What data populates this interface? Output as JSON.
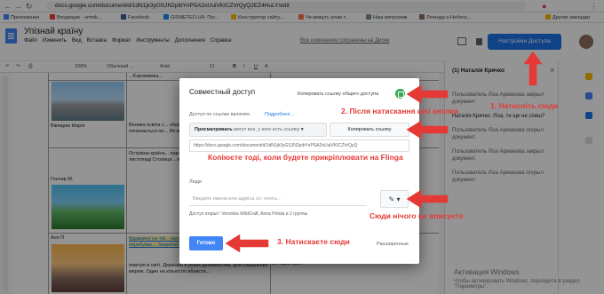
{
  "browser": {
    "url": "docs.google.com/document/d/1dN1jk3yGSJN2pibYnPSA2oUuiVKICZVrQyQ2EZ4HuLY/edit",
    "bookmarks": [
      "Приложения",
      "Входящие - ummk...",
      "Facebook",
      "GISMETEO.UA: Пог...",
      "Конструктор сайту...",
      "Чи можуть річки т...",
      "Наш випускник",
      "Легенда о Небесн...",
      "Другие закладки"
    ]
  },
  "docs": {
    "title": "Упізнай країну",
    "menu": [
      "Файл",
      "Изменить",
      "Вид",
      "Вставка",
      "Формат",
      "Инструменты",
      "Дополнения",
      "Справка"
    ],
    "last_edit": "Все изменения сохранены на Диске",
    "share_button": "Настройки Доступа",
    "toolbar": {
      "zoom": "100%",
      "style": "Обычный ...",
      "font": "Arial",
      "size": "11"
    }
  },
  "document": {
    "rows": [
      {
        "name": "",
        "text": "...Єзромамка..."
      },
      {
        "name": "Вівчарик Марія",
        "text": "Велика освіта с... обов'язкова, а... неграмотним. Не... починається не... Як можна дістатися... інформацією?"
      },
      {
        "name": "Гончар М.",
        "text": "Острівна країна... паралелі, низькі... сухий, особливо... листопаді Столиця... яку мають своє... ріка Банда."
      },
      {
        "name": "Аня П",
        "text": "Вдавнину на тій... населення Зем... рівні забрудненн... влади перебуває... Закритий доступ... З світових лідерів"
      },
      {
        "name": "",
        "text": "повітря в світі. Держава в руках духовенства. для соціальних мереж. Один на кількістю вбивств..."
      }
    ],
    "right_cell": "вівчарик Іран"
  },
  "comments": {
    "author": "(1) Наталія Крячко",
    "items": [
      "Пользователь Ліза Арманова закрыл документ.",
      "Наталія Крячко: Ліза, ти ще не спиш?",
      "Пользователь Ліза Арманова открыл документ.",
      "Пользователь Ліза Арманова закрыл документ.",
      "Пользователь Ліза Арманова открыл документ."
    ]
  },
  "windows": {
    "activation_title": "Активация Windows",
    "activation_text": "Чтобы активировать Windows, перейдите в раздел \"Параметры\"."
  },
  "dialog": {
    "title": "Совместный доступ",
    "copy_shared_link": "Копировать ссылку общего доступа",
    "link_enabled": "Доступ по ссылке включен",
    "more": "Подробнее...",
    "access_bold": "Просматривать",
    "access_rest": "могут все, у кого есть ссылку",
    "copy_link_button": "Копировать ссылку",
    "link": "https://docs.google.com/document/d/1dN1jk3yGSJN2pibYnPSA2oUuiVKICZVrQyQ",
    "people_label": "Люди",
    "people_placeholder": "Введите имена или адреса эл. почты...",
    "open_for": "Доступ открыт: Veronika WildCraft, Anna Pritula и 2 группы",
    "done_button": "Готово",
    "advanced": "Расширенные"
  },
  "annotations": {
    "a1": "1. Натисніть сюди",
    "a2": "2. Після натискання цієї кнопки",
    "a3": "Копіюєте тоді, коли будете прикріплювати на Flinga",
    "a4": "Сюди нічого не вписуєте",
    "a5": "3. Натискаєте сюди"
  },
  "colors": {
    "share_blue": "#1a73e8",
    "annotation_red": "#e53935",
    "highlight": "#fff59d"
  }
}
